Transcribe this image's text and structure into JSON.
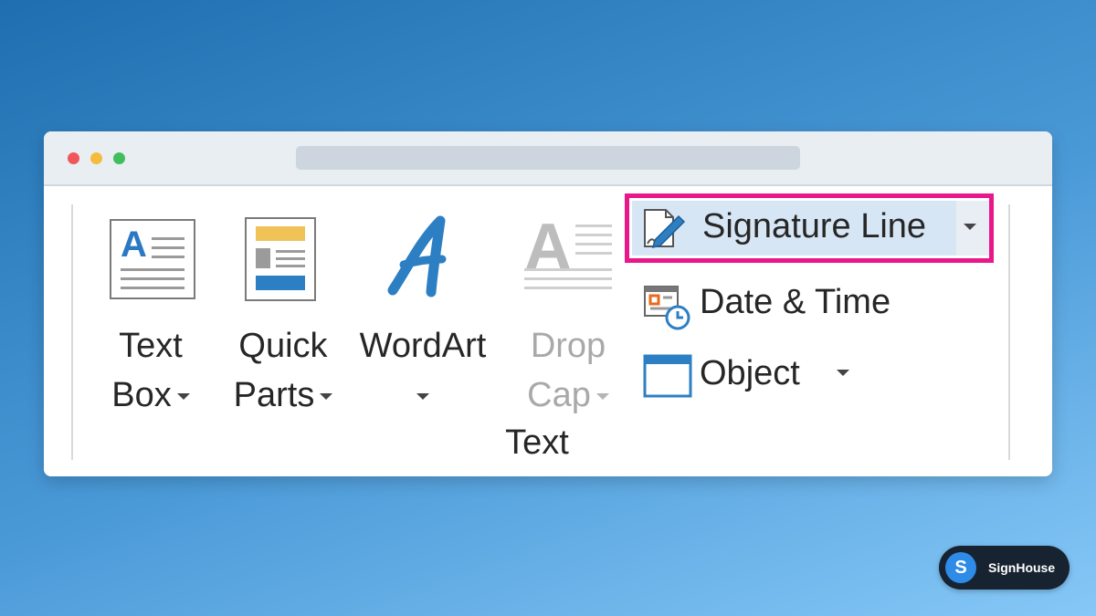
{
  "window": {
    "traffic_lights": [
      "close",
      "minimize",
      "maximize"
    ]
  },
  "ribbon": {
    "group_label": "Text",
    "buttons": [
      {
        "line1": "Text",
        "line2": "Box",
        "icon": "text-box-icon",
        "enabled": true
      },
      {
        "line1": "Quick",
        "line2": "Parts",
        "icon": "quick-parts-icon",
        "enabled": true
      },
      {
        "line1": "WordArt",
        "line2": "",
        "icon": "wordart-icon",
        "enabled": true
      },
      {
        "line1": "Drop",
        "line2": "Cap",
        "icon": "drop-cap-icon",
        "enabled": false
      }
    ],
    "small_buttons": [
      {
        "label": "Signature Line",
        "icon": "signature-line-icon",
        "highlighted": true
      },
      {
        "label": "Date & Time",
        "icon": "date-time-icon"
      },
      {
        "label": "Object",
        "icon": "object-icon"
      }
    ]
  },
  "badge": {
    "logo_letter": "S",
    "name": "SignHouse"
  },
  "colors": {
    "highlight_border": "#e8178a",
    "accent_blue": "#2d7fc4",
    "background_gradient_start": "#1f6fb0",
    "background_gradient_end": "#86c8f7"
  }
}
